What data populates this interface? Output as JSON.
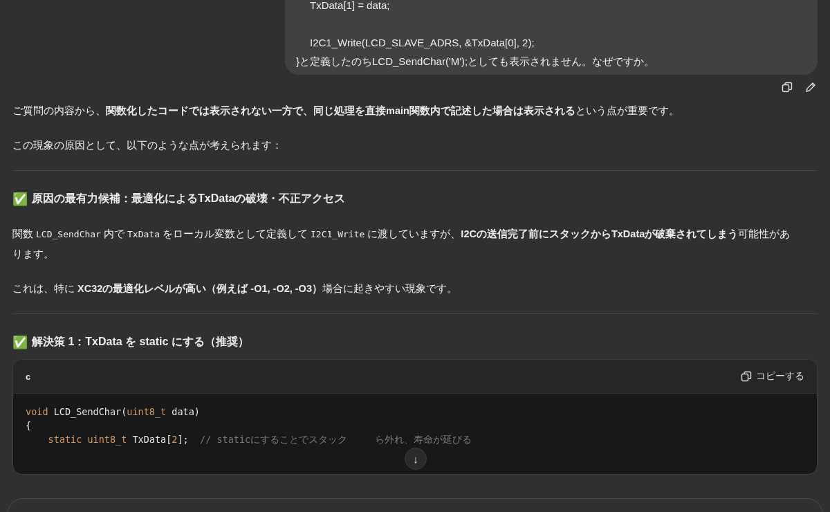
{
  "user_message": {
    "lines": [
      {
        "kind": "indented",
        "text": "TxData[1] = data;"
      },
      {
        "kind": "blank"
      },
      {
        "kind": "indented",
        "text": "I2C1_Write(LCD_SLAVE_ADRS, &TxData[0], 2);"
      },
      {
        "kind": "text",
        "text": "}と定義したのちLCD_SendChar('M');としても表示されません。なぜですか。"
      }
    ]
  },
  "message_actions": [
    {
      "kind": "copy"
    },
    {
      "kind": "edit"
    }
  ],
  "answer": [
    {
      "kind": "paragraph",
      "segments": [
        {
          "kind": "plain",
          "text": "ご質問の内容から、"
        },
        {
          "kind": "bold",
          "text": "関数化したコードでは表示されない一方で、同じ処理を直接main関数内で記述した場合は表示される"
        },
        {
          "kind": "plain",
          "text": "という点が重要です。"
        }
      ]
    },
    {
      "kind": "paragraph",
      "segments": [
        {
          "kind": "plain",
          "text": "この現象の原因として、以下のような点が考えられます："
        }
      ]
    },
    {
      "kind": "rule"
    },
    {
      "kind": "heading",
      "emoji": "✅",
      "text": "原因の最有力候補：最適化によるTxDataの破壊・不正アクセス"
    },
    {
      "kind": "paragraph",
      "segments": [
        {
          "kind": "plain",
          "text": "関数 "
        },
        {
          "kind": "code",
          "text": "LCD_SendChar"
        },
        {
          "kind": "plain",
          "text": " 内で "
        },
        {
          "kind": "code",
          "text": "TxData"
        },
        {
          "kind": "plain",
          "text": " をローカル変数として定義して "
        },
        {
          "kind": "code",
          "text": "I2C1_Write"
        },
        {
          "kind": "plain",
          "text": " に渡していますが、"
        },
        {
          "kind": "bold",
          "text": "I2Cの送信完了前にスタックからTxDataが破棄されてしまう"
        },
        {
          "kind": "plain",
          "text": "可能性があります。"
        }
      ]
    },
    {
      "kind": "paragraph",
      "segments": [
        {
          "kind": "plain",
          "text": "これは、特に "
        },
        {
          "kind": "bold",
          "text": "XC32の最適化レベルが高い（例えば -O1, -O2, -O3）"
        },
        {
          "kind": "plain",
          "text": "場合に起きやすい現象です。"
        }
      ]
    },
    {
      "kind": "rule"
    },
    {
      "kind": "heading",
      "emoji": "✅",
      "text": "解決策 1：TxData を static にする（推奨）"
    },
    {
      "kind": "code_block",
      "language": "c",
      "copy_label": "コピーする",
      "lines": [
        [
          {
            "kind": "keyword",
            "text": "void"
          },
          {
            "kind": "plain",
            "text": " LCD_SendChar("
          },
          {
            "kind": "keyword",
            "text": "uint8_t"
          },
          {
            "kind": "plain",
            "text": " data)"
          }
        ],
        [
          {
            "kind": "plain",
            "text": "{"
          }
        ],
        [
          {
            "kind": "indent"
          },
          {
            "kind": "keyword",
            "text": "static"
          },
          {
            "kind": "space"
          },
          {
            "kind": "keyword",
            "text": "uint8_t"
          },
          {
            "kind": "plain",
            "text": " TxData["
          },
          {
            "kind": "number",
            "text": "2"
          },
          {
            "kind": "plain",
            "text": "];"
          },
          {
            "kind": "comment",
            "text": "// staticにすることでスタック"
          },
          {
            "kind": "comment_after_gap",
            "text": "ら外れ、寿命が延びる"
          }
        ]
      ]
    }
  ],
  "scroll_down_button": {
    "symbol": "↓"
  }
}
